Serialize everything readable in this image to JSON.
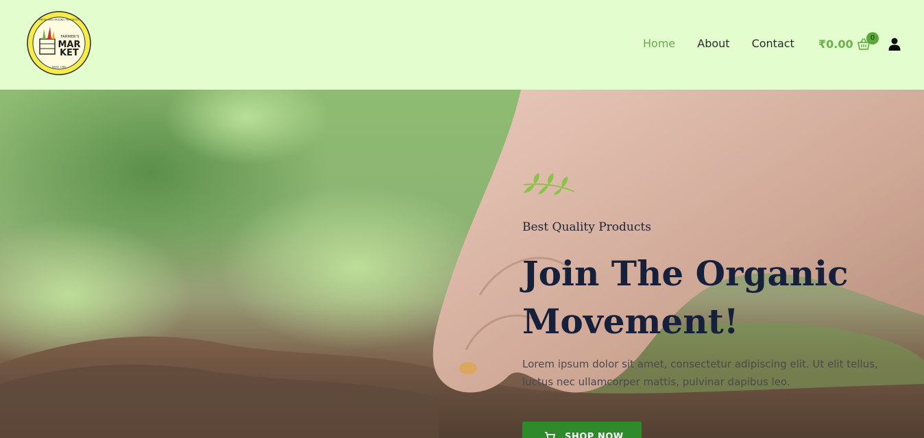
{
  "header": {
    "logo": {
      "top_text": "FARMER'S",
      "line1": "MAR",
      "line2": "KET",
      "ring_top": "FRESH AND ORGANIC PRODUCTS",
      "ring_bottom": "SINCE 1985"
    },
    "nav": [
      {
        "label": "Home",
        "active": true
      },
      {
        "label": "About",
        "active": false
      },
      {
        "label": "Contact",
        "active": false
      }
    ],
    "cart_total": "₹0.00",
    "cart_count": "0"
  },
  "hero": {
    "subtitle": "Best Quality Products",
    "title": "Join The Organic Movement!",
    "description": "Lorem ipsum dolor sit amet, consectetur adipiscing elit. Ut elit tellus, luctus nec ullamcorper mattis, pulvinar dapibus leo.",
    "button_label": "SHOP NOW"
  },
  "colors": {
    "header_bg": "#e3fdce",
    "accent_green": "#6aa84f",
    "button_green": "#2f8a2c",
    "title_navy": "#16203a"
  },
  "icons": {
    "cart": "shopping-basket-icon",
    "user": "user-icon",
    "leaf": "leaf-sprig-icon",
    "button_cart": "cart-icon"
  }
}
